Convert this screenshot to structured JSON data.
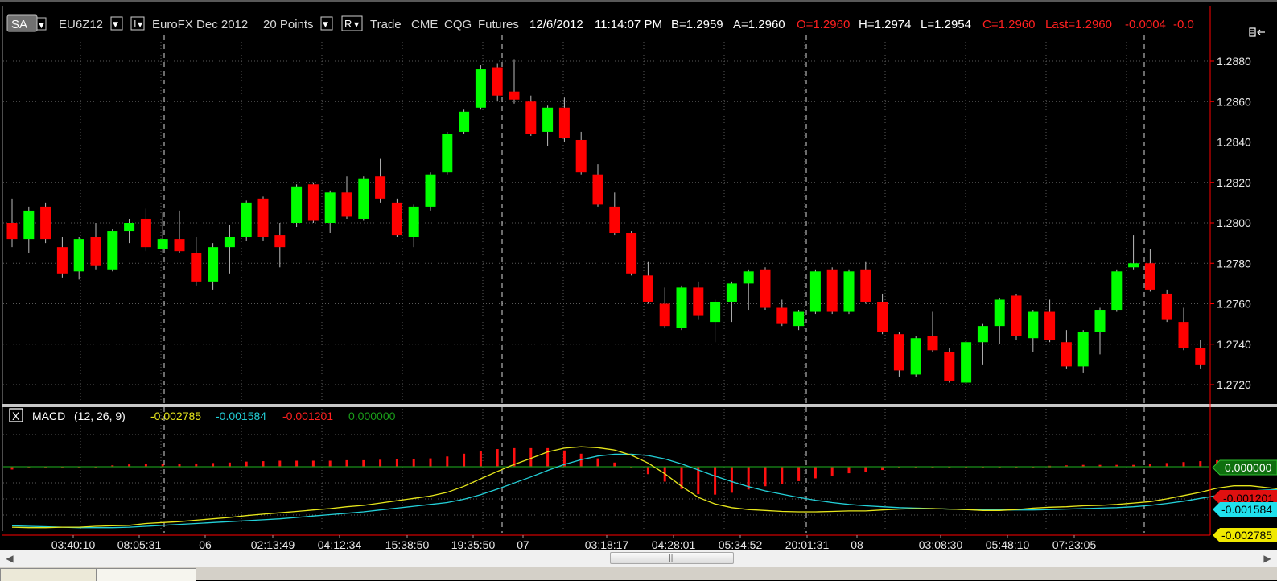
{
  "toolbar": {
    "sa_label": "SA",
    "symbol": "EU6Z12",
    "i_label": "I",
    "instrument_name": "EuroFX Dec 2012",
    "interval": "20 Points",
    "r_label": "R",
    "trade": "Trade",
    "exchange": "CME",
    "feed": "CQG",
    "type": "Futures",
    "date": "12/6/2012",
    "time": "11:14:07 PM",
    "bid": "B=1.2959",
    "ask": "A=1.2960",
    "open": "O=1.2960",
    "high": "H=1.2974",
    "low": "L=1.2954",
    "close": "C=1.2960",
    "last": "Last=1.2960",
    "change": "-0.0004",
    "change_pct": "-0.0"
  },
  "macd_header": {
    "close_label": "X",
    "name": "MACD",
    "params": "(12, 26, 9)",
    "macd_value": "-0.002785",
    "signal_value": "-0.001584",
    "hist_value": "-0.001201",
    "zero_value": "0.000000"
  },
  "colors": {
    "up": "#00ff00",
    "down": "#ff0000",
    "macd_line": "#e6e61c",
    "signal_line": "#23d0d8",
    "hist": "#ff1010",
    "zero_line": "#1a8f1a",
    "grid": "#5a5a5a",
    "axis_red": "#ff0000"
  },
  "chart_data": [
    {
      "type": "candlestick",
      "title": "EuroFX Dec 2012",
      "ylim": [
        1.2712,
        1.2886
      ],
      "y_ticks": [
        "1.2880",
        "1.2860",
        "1.2840",
        "1.2820",
        "1.2800",
        "1.2780",
        "1.2760",
        "1.2740",
        "1.2720"
      ],
      "y_tick_values": [
        1.288,
        1.286,
        1.284,
        1.282,
        1.28,
        1.278,
        1.276,
        1.274,
        1.272
      ],
      "x_labels": [
        "03:40:10",
        "08:05:31",
        "06",
        "02:13:49",
        "04:12:34",
        "15:38:50",
        "19:35:50",
        "07",
        "03:18:17",
        "04:28:01",
        "05:34:52",
        "20:01:31",
        "08",
        "03:08:30",
        "05:48:10",
        "07:23:05"
      ],
      "candles": [
        {
          "o": 1.28,
          "c": 1.2792,
          "h": 1.2812,
          "l": 1.2788
        },
        {
          "o": 1.2792,
          "c": 1.2806,
          "h": 1.2808,
          "l": 1.2785
        },
        {
          "o": 1.2808,
          "c": 1.2792,
          "h": 1.281,
          "l": 1.279
        },
        {
          "o": 1.2788,
          "c": 1.2775,
          "h": 1.2793,
          "l": 1.2773
        },
        {
          "o": 1.2776,
          "c": 1.2792,
          "h": 1.2793,
          "l": 1.2772
        },
        {
          "o": 1.2793,
          "c": 1.2779,
          "h": 1.28,
          "l": 1.2777
        },
        {
          "o": 1.2777,
          "c": 1.2796,
          "h": 1.2797,
          "l": 1.2776
        },
        {
          "o": 1.2796,
          "c": 1.28,
          "h": 1.2802,
          "l": 1.279
        },
        {
          "o": 1.2802,
          "c": 1.2788,
          "h": 1.2807,
          "l": 1.2786
        },
        {
          "o": 1.2787,
          "c": 1.2792,
          "h": 1.2805,
          "l": 1.2785
        },
        {
          "o": 1.2792,
          "c": 1.2786,
          "h": 1.2806,
          "l": 1.2785
        },
        {
          "o": 1.2785,
          "c": 1.2771,
          "h": 1.2793,
          "l": 1.2769
        },
        {
          "o": 1.2771,
          "c": 1.2788,
          "h": 1.279,
          "l": 1.2767
        },
        {
          "o": 1.2788,
          "c": 1.2793,
          "h": 1.2799,
          "l": 1.2775
        },
        {
          "o": 1.2793,
          "c": 1.281,
          "h": 1.2811,
          "l": 1.2791
        },
        {
          "o": 1.2812,
          "c": 1.2793,
          "h": 1.2813,
          "l": 1.2791
        },
        {
          "o": 1.2794,
          "c": 1.2788,
          "h": 1.28,
          "l": 1.2778
        },
        {
          "o": 1.28,
          "c": 1.2818,
          "h": 1.2819,
          "l": 1.2798
        },
        {
          "o": 1.2819,
          "c": 1.2801,
          "h": 1.282,
          "l": 1.28
        },
        {
          "o": 1.28,
          "c": 1.2815,
          "h": 1.2816,
          "l": 1.2795
        },
        {
          "o": 1.2815,
          "c": 1.2803,
          "h": 1.2823,
          "l": 1.2802
        },
        {
          "o": 1.2802,
          "c": 1.2822,
          "h": 1.2823,
          "l": 1.2801
        },
        {
          "o": 1.2823,
          "c": 1.2812,
          "h": 1.2832,
          "l": 1.281
        },
        {
          "o": 1.281,
          "c": 1.2794,
          "h": 1.2812,
          "l": 1.2793
        },
        {
          "o": 1.2793,
          "c": 1.2808,
          "h": 1.2809,
          "l": 1.2788
        },
        {
          "o": 1.2808,
          "c": 1.2824,
          "h": 1.2825,
          "l": 1.2806
        },
        {
          "o": 1.2825,
          "c": 1.2844,
          "h": 1.2845,
          "l": 1.2824
        },
        {
          "o": 1.2845,
          "c": 1.2855,
          "h": 1.2856,
          "l": 1.2844
        },
        {
          "o": 1.2857,
          "c": 1.2876,
          "h": 1.2878,
          "l": 1.2856
        },
        {
          "o": 1.2877,
          "c": 1.2863,
          "h": 1.2879,
          "l": 1.286
        },
        {
          "o": 1.2865,
          "c": 1.2861,
          "h": 1.2881,
          "l": 1.2859
        },
        {
          "o": 1.286,
          "c": 1.2844,
          "h": 1.2863,
          "l": 1.2843
        },
        {
          "o": 1.2845,
          "c": 1.2857,
          "h": 1.2858,
          "l": 1.2838
        },
        {
          "o": 1.2857,
          "c": 1.2842,
          "h": 1.2862,
          "l": 1.284
        },
        {
          "o": 1.2841,
          "c": 1.2825,
          "h": 1.2845,
          "l": 1.2824
        },
        {
          "o": 1.2824,
          "c": 1.2809,
          "h": 1.2829,
          "l": 1.2808
        },
        {
          "o": 1.2808,
          "c": 1.2795,
          "h": 1.2815,
          "l": 1.2794
        },
        {
          "o": 1.2795,
          "c": 1.2775,
          "h": 1.2796,
          "l": 1.2774
        },
        {
          "o": 1.2774,
          "c": 1.2761,
          "h": 1.2781,
          "l": 1.276
        },
        {
          "o": 1.276,
          "c": 1.2749,
          "h": 1.2768,
          "l": 1.2748
        },
        {
          "o": 1.2748,
          "c": 1.2768,
          "h": 1.2769,
          "l": 1.2747
        },
        {
          "o": 1.2768,
          "c": 1.2754,
          "h": 1.2771,
          "l": 1.2752
        },
        {
          "o": 1.2751,
          "c": 1.2761,
          "h": 1.2762,
          "l": 1.2741
        },
        {
          "o": 1.2761,
          "c": 1.277,
          "h": 1.2771,
          "l": 1.2751
        },
        {
          "o": 1.277,
          "c": 1.2776,
          "h": 1.2777,
          "l": 1.2757
        },
        {
          "o": 1.2777,
          "c": 1.2758,
          "h": 1.2778,
          "l": 1.2757
        },
        {
          "o": 1.2758,
          "c": 1.275,
          "h": 1.2762,
          "l": 1.2749
        },
        {
          "o": 1.2749,
          "c": 1.2756,
          "h": 1.2757,
          "l": 1.2747
        },
        {
          "o": 1.2756,
          "c": 1.2776,
          "h": 1.2777,
          "l": 1.2755
        },
        {
          "o": 1.2777,
          "c": 1.2756,
          "h": 1.2778,
          "l": 1.2755
        },
        {
          "o": 1.2756,
          "c": 1.2776,
          "h": 1.2777,
          "l": 1.2755
        },
        {
          "o": 1.2777,
          "c": 1.2761,
          "h": 1.2781,
          "l": 1.276
        },
        {
          "o": 1.2761,
          "c": 1.2746,
          "h": 1.2765,
          "l": 1.2745
        },
        {
          "o": 1.2745,
          "c": 1.2727,
          "h": 1.2746,
          "l": 1.2724
        },
        {
          "o": 1.2725,
          "c": 1.2743,
          "h": 1.2744,
          "l": 1.2724
        },
        {
          "o": 1.2744,
          "c": 1.2737,
          "h": 1.2756,
          "l": 1.2736
        },
        {
          "o": 1.2736,
          "c": 1.2722,
          "h": 1.2738,
          "l": 1.2721
        },
        {
          "o": 1.2721,
          "c": 1.2741,
          "h": 1.2742,
          "l": 1.272
        },
        {
          "o": 1.2741,
          "c": 1.2749,
          "h": 1.275,
          "l": 1.273
        },
        {
          "o": 1.2749,
          "c": 1.2762,
          "h": 1.2763,
          "l": 1.274
        },
        {
          "o": 1.2764,
          "c": 1.2744,
          "h": 1.2765,
          "l": 1.2742
        },
        {
          "o": 1.2743,
          "c": 1.2756,
          "h": 1.2757,
          "l": 1.2736
        },
        {
          "o": 1.2756,
          "c": 1.2742,
          "h": 1.2762,
          "l": 1.2741
        },
        {
          "o": 1.2741,
          "c": 1.2729,
          "h": 1.2747,
          "l": 1.2728
        },
        {
          "o": 1.2729,
          "c": 1.2746,
          "h": 1.2747,
          "l": 1.2726
        },
        {
          "o": 1.2746,
          "c": 1.2757,
          "h": 1.2758,
          "l": 1.2735
        },
        {
          "o": 1.2757,
          "c": 1.2776,
          "h": 1.2777,
          "l": 1.2756
        },
        {
          "o": 1.2778,
          "c": 1.278,
          "h": 1.2794,
          "l": 1.2777
        },
        {
          "o": 1.278,
          "c": 1.2767,
          "h": 1.2787,
          "l": 1.2766
        },
        {
          "o": 1.2765,
          "c": 1.2752,
          "h": 1.2767,
          "l": 1.2751
        },
        {
          "o": 1.2751,
          "c": 1.2738,
          "h": 1.2758,
          "l": 1.2737
        },
        {
          "o": 1.2738,
          "c": 1.273,
          "h": 1.2742,
          "l": 1.2728
        }
      ]
    },
    {
      "type": "line",
      "title": "MACD (12, 26, 9)",
      "ylim": [
        -0.0135,
        0.0068
      ],
      "y_ticks": [
        "0.000000",
        "-0.001201",
        "-0.001584",
        "-0.002785"
      ],
      "series": [
        {
          "name": "MACD",
          "values": [
            -0.013,
            -0.0131,
            -0.0131,
            -0.013,
            -0.013,
            -0.0128,
            -0.0127,
            -0.0126,
            -0.0122,
            -0.012,
            -0.0118,
            -0.0115,
            -0.0112,
            -0.0109,
            -0.0105,
            -0.0102,
            -0.0099,
            -0.0096,
            -0.0093,
            -0.009,
            -0.0086,
            -0.0083,
            -0.0078,
            -0.0073,
            -0.0068,
            -0.0063,
            -0.0055,
            -0.0042,
            -0.0026,
            -0.001,
            0.0005,
            0.0018,
            0.0032,
            0.004,
            0.0043,
            0.0041,
            0.0036,
            0.0025,
            0.0008,
            -0.0015,
            -0.0042,
            -0.0066,
            -0.008,
            -0.0088,
            -0.0092,
            -0.0094,
            -0.0096,
            -0.0097,
            -0.0097,
            -0.0096,
            -0.0095,
            -0.0095,
            -0.0093,
            -0.0091,
            -0.009,
            -0.009,
            -0.0091,
            -0.0092,
            -0.0094,
            -0.0094,
            -0.0092,
            -0.0089,
            -0.0087,
            -0.0086,
            -0.0084,
            -0.0083,
            -0.0081,
            -0.0078,
            -0.0075,
            -0.0069,
            -0.0062,
            -0.0055,
            -0.0046,
            -0.0041,
            -0.0041,
            -0.0045,
            -0.0049
          ]
        },
        {
          "name": "Signal",
          "values": [
            -0.0127,
            -0.0128,
            -0.0129,
            -0.013,
            -0.0131,
            -0.0131,
            -0.0131,
            -0.013,
            -0.0128,
            -0.0126,
            -0.0124,
            -0.0122,
            -0.012,
            -0.0118,
            -0.0116,
            -0.0114,
            -0.0112,
            -0.0109,
            -0.0106,
            -0.0103,
            -0.01,
            -0.0097,
            -0.0093,
            -0.0089,
            -0.0085,
            -0.0081,
            -0.0077,
            -0.007,
            -0.006,
            -0.0048,
            -0.0035,
            -0.0022,
            -0.0008,
            0.0005,
            0.0015,
            0.0023,
            0.0027,
            0.0027,
            0.0024,
            0.0017,
            0.0006,
            -0.0007,
            -0.002,
            -0.0032,
            -0.0043,
            -0.0052,
            -0.0059,
            -0.0066,
            -0.0072,
            -0.0077,
            -0.0081,
            -0.0084,
            -0.0086,
            -0.0088,
            -0.0089,
            -0.009,
            -0.0091,
            -0.0092,
            -0.0093,
            -0.0093,
            -0.0093,
            -0.0093,
            -0.0092,
            -0.0091,
            -0.009,
            -0.0089,
            -0.0088,
            -0.0086,
            -0.0083,
            -0.0079,
            -0.0074,
            -0.0068,
            -0.0062,
            -0.0056,
            -0.0052,
            -0.005,
            -0.0049
          ]
        },
        {
          "name": "Histogram",
          "values": [
            -0.0006,
            -0.0003,
            -0.0002,
            -0.0002,
            -0.0001,
            0.0,
            0.0003,
            0.0005,
            0.0006,
            0.0006,
            0.0006,
            0.0007,
            0.0008,
            0.0009,
            0.0011,
            0.0012,
            0.0013,
            0.0013,
            0.0013,
            0.0013,
            0.0014,
            0.0014,
            0.0015,
            0.0016,
            0.0017,
            0.0018,
            0.0022,
            0.0028,
            0.0034,
            0.0038,
            0.004,
            0.004,
            0.004,
            0.0035,
            0.0028,
            0.0018,
            0.0009,
            -0.0002,
            -0.0016,
            -0.0032,
            -0.0048,
            -0.0059,
            -0.006,
            -0.0056,
            -0.0049,
            -0.0042,
            -0.0037,
            -0.0031,
            -0.0025,
            -0.0019,
            -0.0014,
            -0.0011,
            -0.0007,
            -0.0003,
            -0.0001,
            0.0,
            -0.0001,
            -0.0002,
            -0.0002,
            -0.0002,
            -0.0002,
            0.0,
            0.0002,
            0.0003,
            0.0004,
            0.0004,
            0.0004,
            0.0004,
            0.0006,
            0.0008,
            0.001,
            0.0012,
            0.0014,
            0.0013,
            0.001,
            0.0006,
            0.0
          ]
        }
      ]
    }
  ]
}
